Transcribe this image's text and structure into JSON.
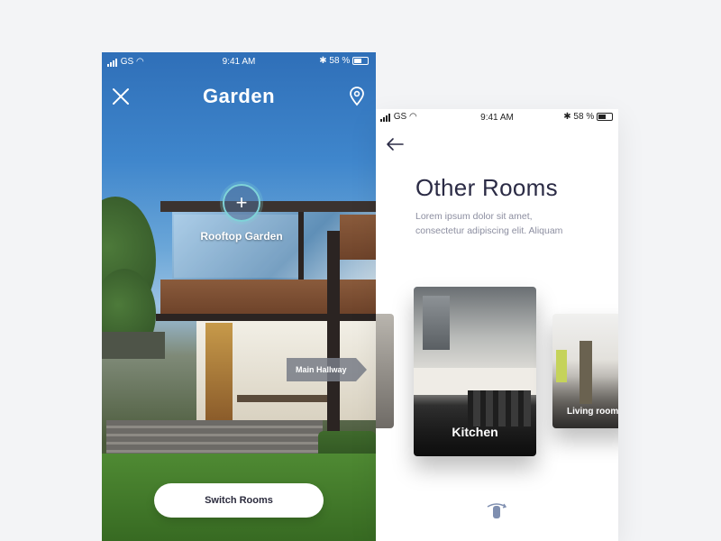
{
  "left_screen": {
    "status_bar": {
      "carrier": "GS",
      "time": "9:41 AM",
      "battery": "58 %"
    },
    "title": "Garden",
    "hotspots": {
      "rooftop_label": "Rooftop Garden",
      "hallway_label": "Main Hallway"
    },
    "switch_button": "Switch Rooms",
    "icons": {
      "close": "close-icon",
      "location": "location-pin-icon",
      "add": "plus-icon"
    }
  },
  "right_screen": {
    "status_bar": {
      "carrier": "GS",
      "time": "9:41 AM",
      "battery": "58 %"
    },
    "title": "Other Rooms",
    "description_line1": "Lorem ipsum dolor sit amet,",
    "description_line2": "consectetur adipiscing elit. Aliquam",
    "rooms": [
      {
        "label": "Kitchen"
      },
      {
        "label": "Living room"
      }
    ],
    "icons": {
      "back": "arrow-left-icon",
      "swipe": "swipe-gesture-icon"
    }
  },
  "colors": {
    "accent": "#7fd3d8",
    "title_dark": "#2b2b45",
    "muted_text": "#8c8ea0"
  }
}
